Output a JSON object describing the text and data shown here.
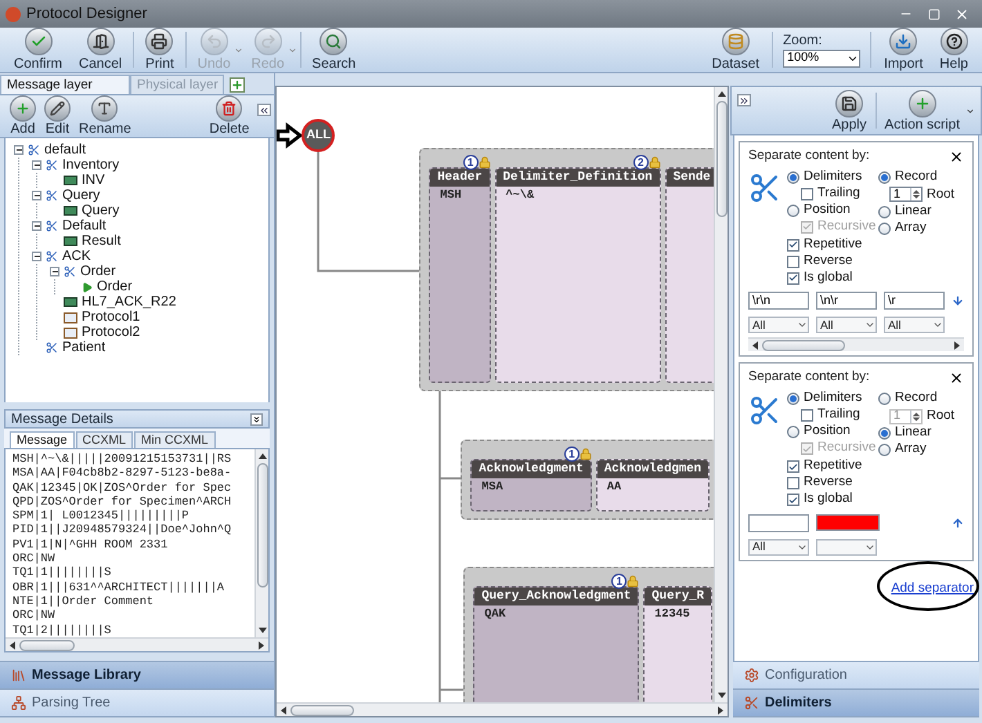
{
  "window": {
    "title": "Protocol Designer"
  },
  "toolbar": {
    "left": [
      {
        "label": "Confirm",
        "kind": "confirm",
        "disabled": false
      },
      {
        "label": "Cancel",
        "kind": "cancel",
        "disabled": false
      },
      {
        "label": "Print",
        "kind": "print",
        "disabled": false
      },
      {
        "label": "Undo",
        "kind": "undo",
        "disabled": true
      },
      {
        "label": "Redo",
        "kind": "redo",
        "disabled": true
      },
      {
        "label": "Search",
        "kind": "search",
        "disabled": false
      }
    ],
    "right": [
      {
        "label": "Dataset",
        "kind": "dataset",
        "disabled": false
      },
      {
        "label": "Zoom:",
        "kind": "zoom",
        "value": "100%",
        "disabled": false
      },
      {
        "label": "Import",
        "kind": "import",
        "disabled": false
      },
      {
        "label": "Help",
        "kind": "help",
        "disabled": false
      }
    ]
  },
  "layer_tabs": [
    {
      "label": "Message layer",
      "selected": true
    },
    {
      "label": "Physical layer",
      "selected": false
    }
  ],
  "tree_toolbar": [
    {
      "label": "Add",
      "kind": "add"
    },
    {
      "label": "Edit",
      "kind": "edit"
    },
    {
      "label": "Rename",
      "kind": "rename"
    },
    {
      "label": "Delete",
      "kind": "delete"
    }
  ],
  "tree": [
    {
      "label": "default",
      "kind": "group",
      "expanded": true,
      "children": [
        {
          "label": "Inventory",
          "kind": "group",
          "expanded": true,
          "children": [
            {
              "label": "INV",
              "kind": "message"
            }
          ]
        },
        {
          "label": "Query",
          "kind": "group",
          "expanded": true,
          "children": [
            {
              "label": "Query",
              "kind": "message"
            }
          ]
        },
        {
          "label": "Default",
          "kind": "group",
          "expanded": true,
          "children": [
            {
              "label": "Result",
              "kind": "message"
            }
          ]
        },
        {
          "label": "ACK",
          "kind": "group",
          "expanded": true,
          "children": [
            {
              "label": "Order",
              "kind": "group",
              "expanded": true,
              "children": [
                {
                  "label": "Order",
                  "kind": "segment"
                }
              ]
            },
            {
              "label": "HL7_ACK_R22",
              "kind": "message"
            },
            {
              "label": "Protocol1",
              "kind": "protocol"
            },
            {
              "label": "Protocol2",
              "kind": "protocol"
            }
          ]
        },
        {
          "label": "Patient",
          "kind": "group"
        }
      ]
    }
  ],
  "message_details": {
    "title": "Message Details",
    "tabs": [
      {
        "label": "Message",
        "selected": true
      },
      {
        "label": "CCXML",
        "selected": false
      },
      {
        "label": "Min CCXML",
        "selected": false
      }
    ],
    "lines": [
      "MSH|^~\\&|||||20091215153731||RS",
      "MSA|AA|F04cb8b2-8297-5123-be8a-",
      "QAK|12345|OK|ZOS^Order for Spec",
      "QPD|ZOS^Order for Specimen^ARCH",
      "SPM|1| L0012345|||||||||P",
      "PID|1||J20948579324||Doe^John^Q",
      "PV1|1|N|^GHH ROOM 2331",
      "ORC|NW",
      "TQ1|1||||||||S",
      "OBR|1|||631^^ARCHITECT|||||||A",
      "NTE|1||Order Comment",
      "ORC|NW",
      "TQ1|2||||||||S"
    ]
  },
  "left_nav": [
    {
      "label": "Message Library",
      "kind": "library",
      "selected": true
    },
    {
      "label": "Parsing Tree",
      "kind": "tree",
      "selected": false
    }
  ],
  "canvas": {
    "root_node": {
      "label": "ALL"
    },
    "groups": [
      {
        "columns": [
          {
            "name": "Header",
            "value": "MSH",
            "kind": "key",
            "badge": "1"
          },
          {
            "name": "Delimiter_Definition",
            "value": "^~\\&",
            "kind": "value",
            "badge": "2"
          },
          {
            "name": "Sende",
            "kind": "value"
          }
        ]
      },
      {
        "columns": [
          {
            "name": "Acknowledgment",
            "value": "MSA",
            "kind": "key",
            "badge": "1"
          },
          {
            "name": "Acknowledgmen",
            "value": "AA",
            "kind": "value"
          }
        ]
      },
      {
        "columns": [
          {
            "name": "Query_Acknowledgment",
            "value": "QAK",
            "kind": "key",
            "badge": "1"
          },
          {
            "name": "Query_R",
            "value": "12345",
            "kind": "value"
          }
        ]
      }
    ]
  },
  "right_toolbar": [
    {
      "label": "Apply",
      "kind": "apply"
    },
    {
      "label": "Action script",
      "kind": "script"
    }
  ],
  "separators": [
    {
      "title": "Separate content by:",
      "modes": [
        {
          "label": "Delimiters",
          "selected": true
        },
        {
          "label": "Position",
          "selected": false
        }
      ],
      "trailing": {
        "label": "Trailing",
        "checked": false
      },
      "recursive": {
        "label": "Recursive",
        "checked": true,
        "disabled": true
      },
      "structures": [
        {
          "label": "Record",
          "selected": true
        },
        {
          "label": "Linear",
          "selected": false
        },
        {
          "label": "Array",
          "selected": false
        }
      ],
      "record_count": {
        "value": "1",
        "disabled": false
      },
      "root_label": "Root",
      "options": [
        {
          "label": "Repetitive",
          "checked": true
        },
        {
          "label": "Reverse",
          "checked": false
        },
        {
          "label": "Is global",
          "checked": true
        }
      ],
      "delimiters": [
        {
          "kind": "text",
          "value": "\\r\\n"
        },
        {
          "kind": "text",
          "value": "\\n\\r"
        },
        {
          "kind": "text",
          "value": "\\r"
        }
      ],
      "scopes": [
        {
          "kind": "value",
          "value": "All"
        },
        {
          "kind": "value",
          "value": "All"
        },
        {
          "kind": "value",
          "value": "All"
        }
      ]
    },
    {
      "title": "Separate content by:",
      "modes": [
        {
          "label": "Delimiters",
          "selected": true
        },
        {
          "label": "Position",
          "selected": false
        }
      ],
      "trailing": {
        "label": "Trailing",
        "checked": false
      },
      "recursive": {
        "label": "Recursive",
        "checked": true,
        "disabled": true
      },
      "structures": [
        {
          "label": "Record",
          "selected": false
        },
        {
          "label": "Linear",
          "selected": true
        },
        {
          "label": "Array",
          "selected": false
        }
      ],
      "record_count": {
        "value": "1",
        "disabled": true
      },
      "root_label": "Root",
      "options": [
        {
          "label": "Repetitive",
          "checked": true
        },
        {
          "label": "Reverse",
          "checked": false
        },
        {
          "label": "Is global",
          "checked": true
        }
      ],
      "delimiters": [
        {
          "kind": "text"
        },
        {
          "kind": "color",
          "color": "#ff0000"
        }
      ],
      "scopes": [
        {
          "kind": "value",
          "value": "All"
        },
        {
          "kind": "blank"
        }
      ]
    }
  ],
  "add_separator": {
    "label": "Add separator"
  },
  "right_nav": [
    {
      "label": "Configuration",
      "kind": "configuration",
      "selected": false
    },
    {
      "label": "Delimiters",
      "kind": "delimiters",
      "selected": true
    }
  ]
}
